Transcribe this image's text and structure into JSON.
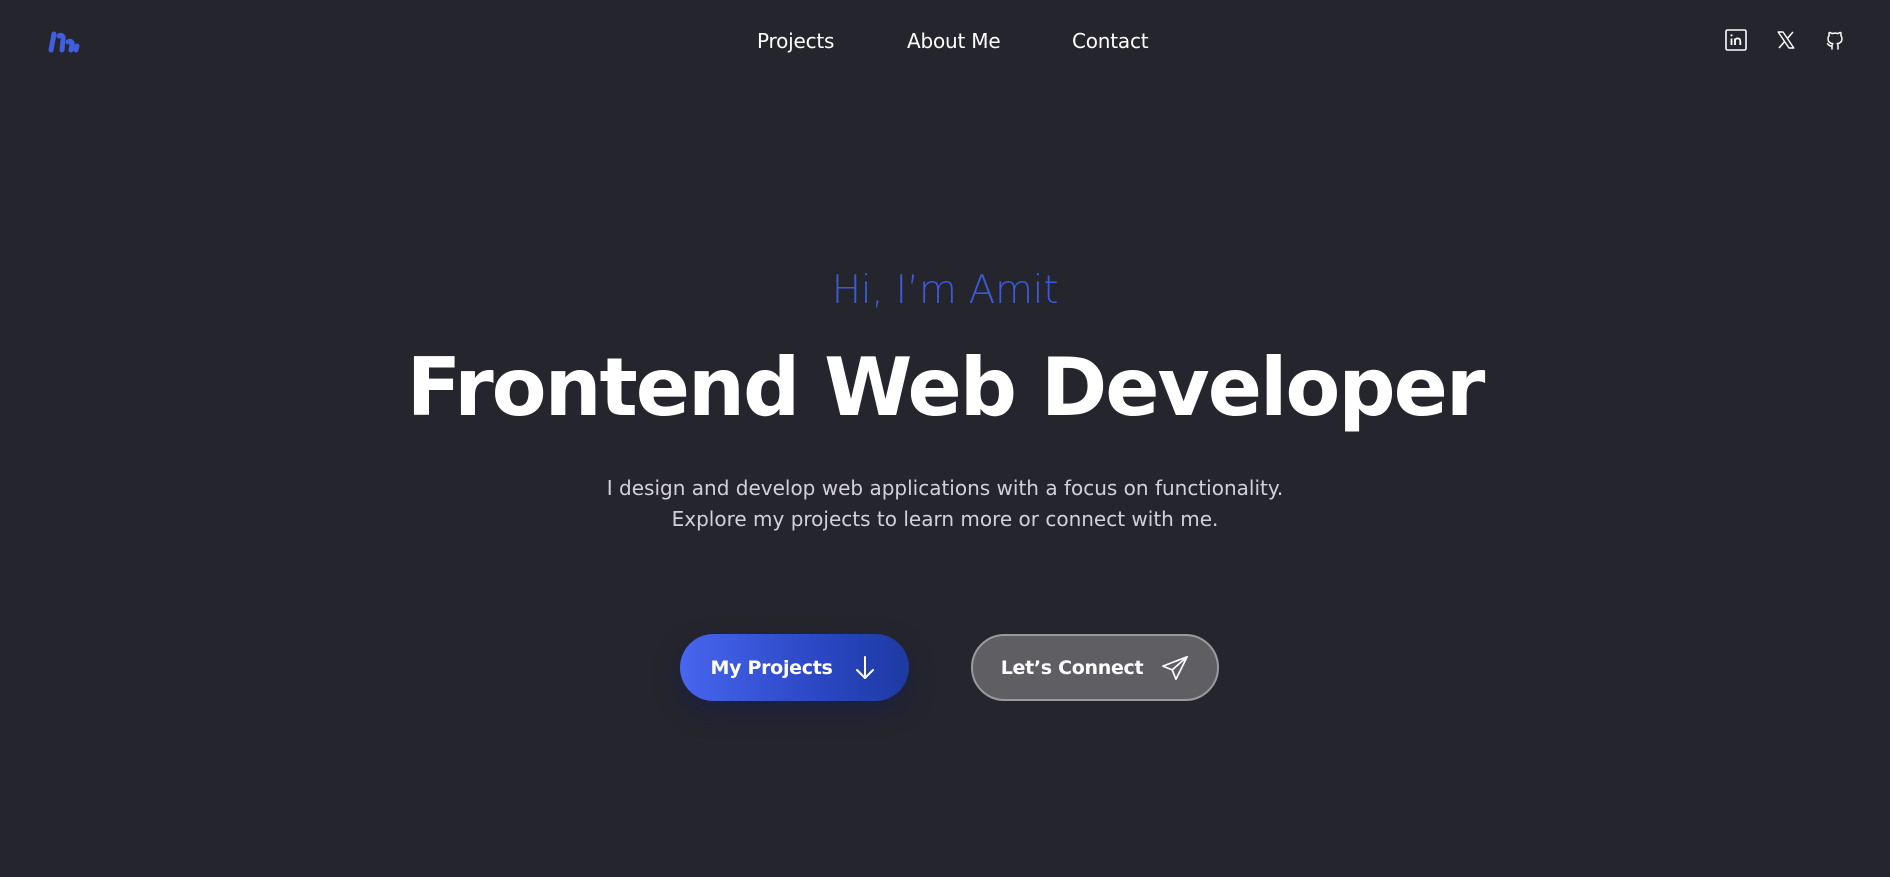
{
  "header": {
    "nav": {
      "projects_label": "Projects",
      "about_label": "About Me",
      "contact_label": "Contact"
    },
    "social": {
      "linkedin_icon": "linkedin-icon",
      "x_icon": "x-icon",
      "github_icon": "github-icon"
    }
  },
  "hero": {
    "greeting": "Hi, I’m Amit",
    "headline": "Frontend Web Developer",
    "subtitle_line1": "I design and develop web applications with a focus on functionality.",
    "subtitle_line2": "Explore my projects to learn more or connect with me.",
    "primary_button_label": "My Projects",
    "primary_button_icon": "arrow-down-icon",
    "secondary_button_label": "Let’s Connect",
    "secondary_button_icon": "paper-plane-icon"
  },
  "colors": {
    "background": "#25252d",
    "accent": "#3c5ad8",
    "primary_button_start": "#4766ee",
    "primary_button_end": "#1d3aa2",
    "secondary_button": "#5e5e63"
  }
}
